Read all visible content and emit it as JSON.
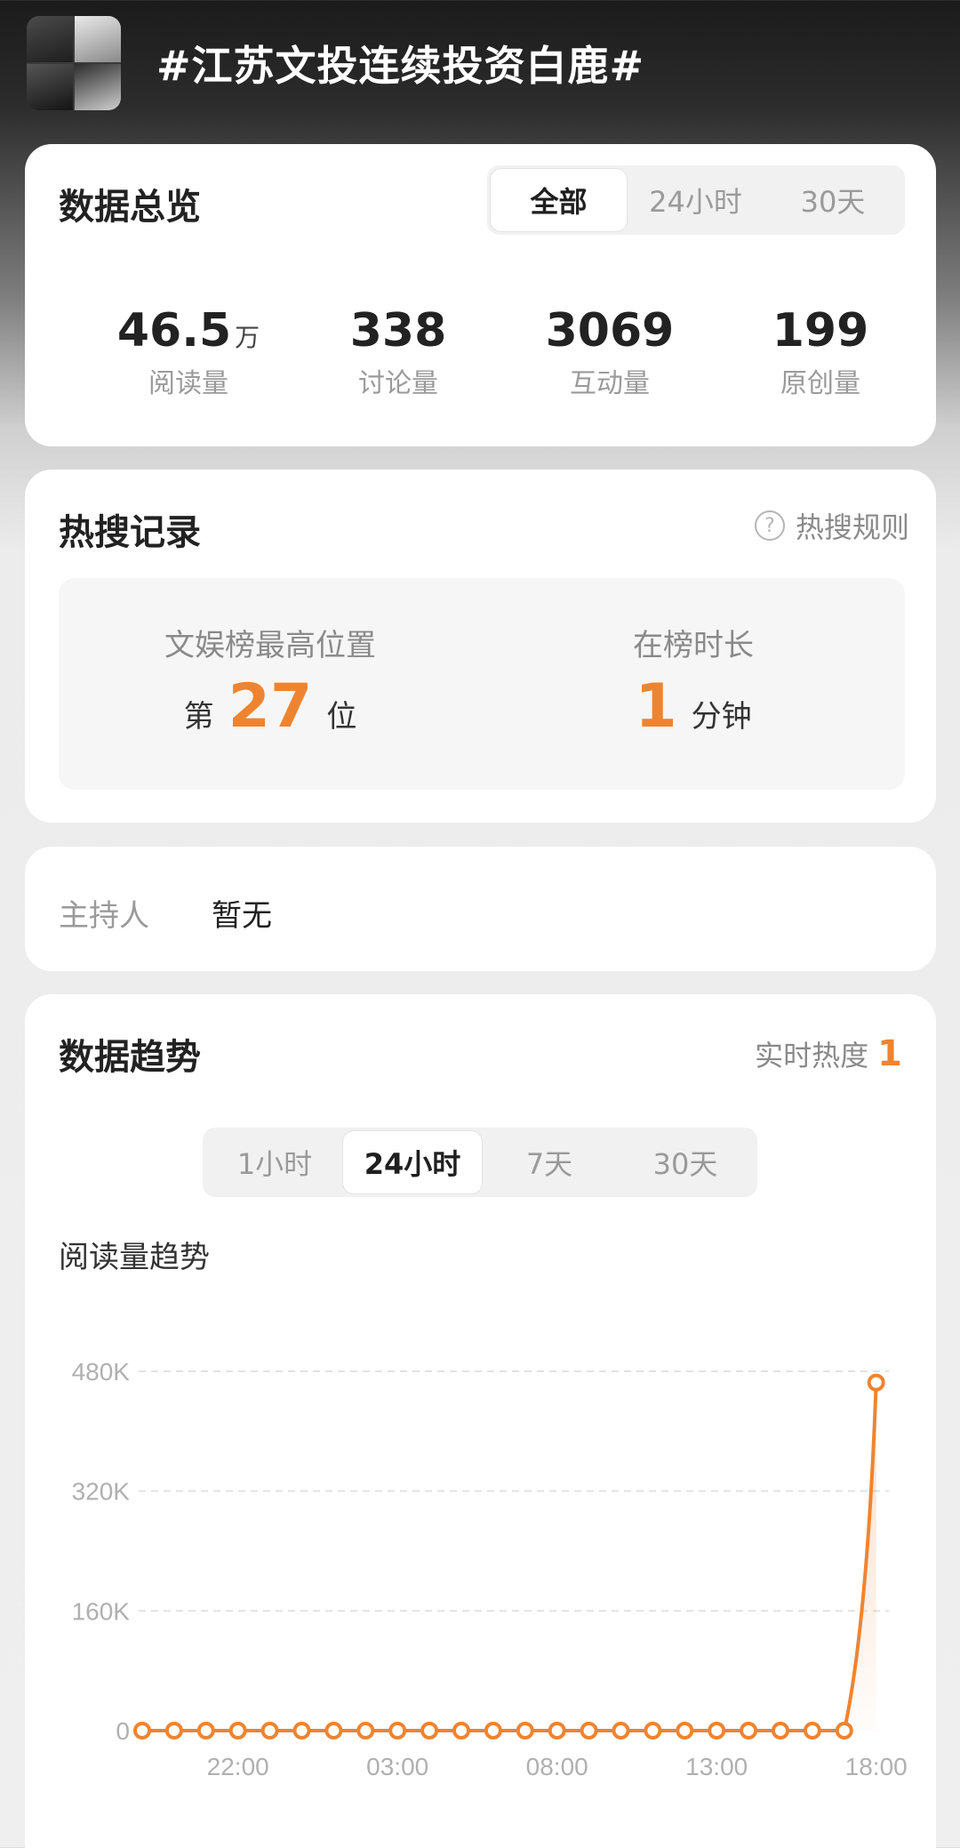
{
  "header": {
    "topic_title": "#江苏文投连续投资白鹿#"
  },
  "overview": {
    "title": "数据总览",
    "tabs": [
      "全部",
      "24小时",
      "30天"
    ],
    "active_tab": "全部",
    "stats": [
      {
        "value": "46.5",
        "unit": "万",
        "label": "阅读量"
      },
      {
        "value": "338",
        "unit": "",
        "label": "讨论量"
      },
      {
        "value": "3069",
        "unit": "",
        "label": "互动量"
      },
      {
        "value": "199",
        "unit": "",
        "label": "原创量"
      }
    ]
  },
  "hot_search": {
    "title": "热搜记录",
    "rules_label": "热搜规则",
    "best_position": {
      "label": "文娱榜最高位置",
      "prefix": "第",
      "value": "27",
      "suffix": "位"
    },
    "duration": {
      "label": "在榜时长",
      "value": "1",
      "suffix": "分钟"
    }
  },
  "host": {
    "label": "主持人",
    "value": "暂无"
  },
  "trend": {
    "title": "数据趋势",
    "heat_label": "实时热度",
    "heat_value": "1",
    "tabs": [
      "1小时",
      "24小时",
      "7天",
      "30天"
    ],
    "active_tab": "24小时",
    "chart_label": "阅读量趋势"
  },
  "chart_data": {
    "type": "line",
    "title": "阅读量趋势",
    "xlabel": "",
    "ylabel": "",
    "ylim": [
      0,
      480000
    ],
    "y_ticks": [
      "0",
      "160K",
      "320K",
      "480K"
    ],
    "x_tick_labels": [
      "22:00",
      "03:00",
      "08:00",
      "13:00",
      "18:00"
    ],
    "x": [
      "19:00",
      "20:00",
      "21:00",
      "22:00",
      "23:00",
      "00:00",
      "01:00",
      "02:00",
      "03:00",
      "04:00",
      "05:00",
      "06:00",
      "07:00",
      "08:00",
      "09:00",
      "10:00",
      "11:00",
      "12:00",
      "13:00",
      "14:00",
      "15:00",
      "16:00",
      "17:00",
      "18:00"
    ],
    "series": [
      {
        "values": [
          0,
          0,
          0,
          0,
          0,
          0,
          0,
          0,
          0,
          0,
          0,
          0,
          0,
          0,
          0,
          0,
          0,
          0,
          0,
          0,
          0,
          0,
          0,
          465000
        ]
      }
    ],
    "grid": true,
    "colors": {
      "line": "#ef8430"
    }
  }
}
